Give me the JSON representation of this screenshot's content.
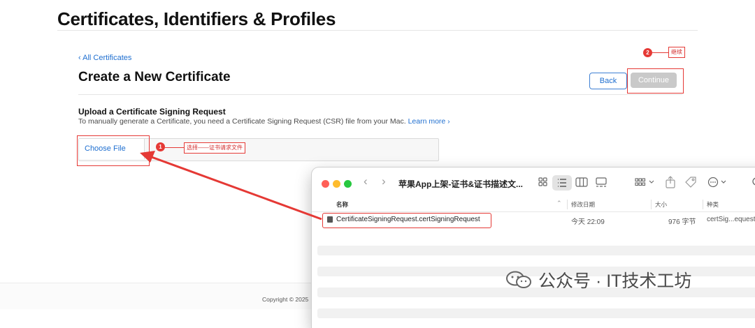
{
  "header": {
    "title": "Certificates, Identifiers & Profiles"
  },
  "nav": {
    "back_link": "‹ All Certificates"
  },
  "page": {
    "title": "Create a New Certificate",
    "back_button": "Back",
    "continue_button": "Continue"
  },
  "upload": {
    "heading": "Upload a Certificate Signing Request",
    "description": "To manually generate a Certificate, you need a Certificate Signing Request (CSR) file from your Mac.",
    "learn_more": "Learn more ›",
    "choose_file": "Choose File"
  },
  "annotations": [
    {
      "number": "1",
      "text": "选择——证书请求文件"
    },
    {
      "number": "2",
      "text": "继续"
    }
  ],
  "annotation_color": "#e53935",
  "footer": {
    "copyright": "Copyright © 2025"
  },
  "finder": {
    "title": "苹果App上架-证书&证书描述文...",
    "columns": {
      "name": "名称",
      "date": "修改日期",
      "size": "大小",
      "kind": "种类"
    },
    "file": {
      "name": "CertificateSigningRequest.certSigningRequest",
      "date": "今天 22:09",
      "size": "976 字节",
      "kind": "certSig...equest"
    }
  },
  "watermark": {
    "text": "公众号 · IT技术工坊"
  },
  "colors": {
    "link": "#1f6fd0",
    "continue_disabled": "#c9c9c9"
  }
}
